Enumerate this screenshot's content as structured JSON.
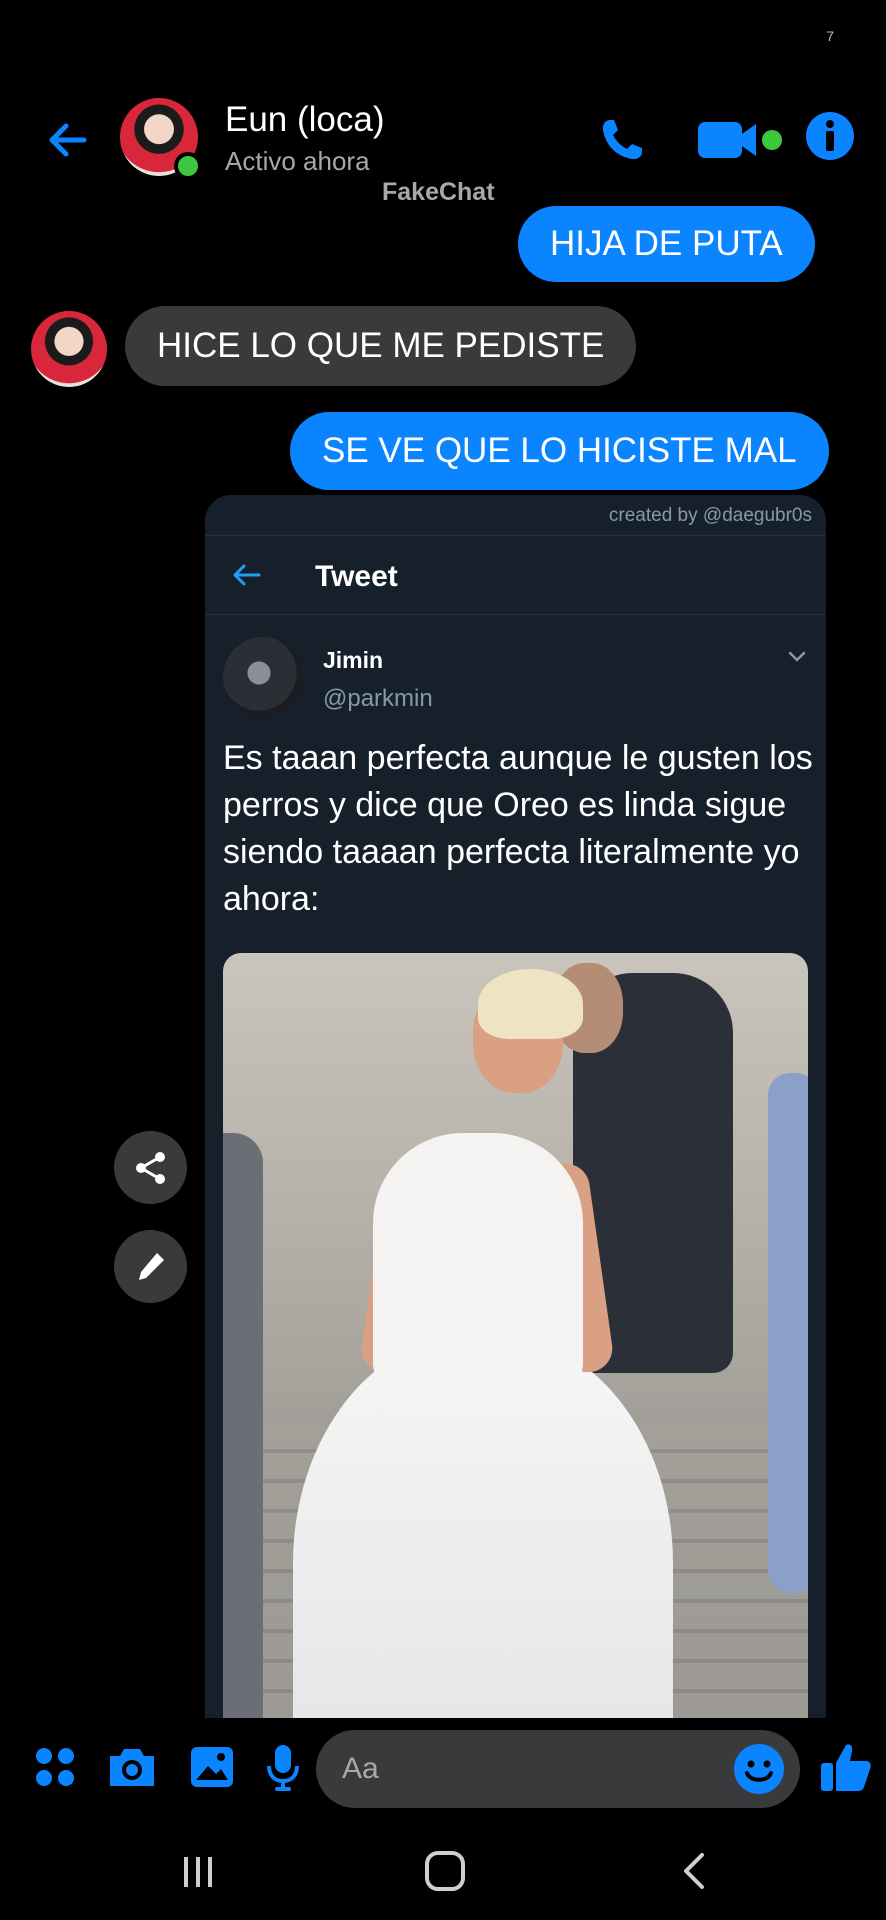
{
  "status_bar": {
    "glyph": "7"
  },
  "header": {
    "contact_name": "Eun (loca)",
    "contact_status": "Activo ahora",
    "watermark": "FakeChat",
    "icons": [
      "back-arrow-icon",
      "phone-icon",
      "video-camera-icon",
      "info-icon"
    ],
    "online": true,
    "accent_color": "#0a84ff",
    "online_color": "#3ec63e"
  },
  "messages": [
    {
      "direction": "sent",
      "text": "HIJA DE PUTA"
    },
    {
      "direction": "received",
      "text": "HICE LO QUE ME PEDISTE"
    },
    {
      "direction": "sent",
      "text": "SE VE QUE LO HICISTE MAL"
    }
  ],
  "tweet_card": {
    "credit": "created by @daegubr0s",
    "topbar_title": "Tweet",
    "author_name": "Jimin",
    "author_handle": "@parkmin",
    "text": "Es taaan perfecta aunque le gusten los perros y dice que Oreo es linda sigue siendo taaaan perfecta literalmente yo ahora:",
    "background_color": "#15202b"
  },
  "floating_buttons": [
    "share-icon",
    "pencil-icon"
  ],
  "composer": {
    "placeholder": "Aa",
    "icons": [
      "apps-grid-icon",
      "camera-icon",
      "gallery-icon",
      "microphone-icon",
      "emoji-icon",
      "thumbs-up-icon"
    ]
  },
  "navbar": {
    "icons": [
      "recent-apps-icon",
      "home-icon",
      "back-icon"
    ]
  }
}
